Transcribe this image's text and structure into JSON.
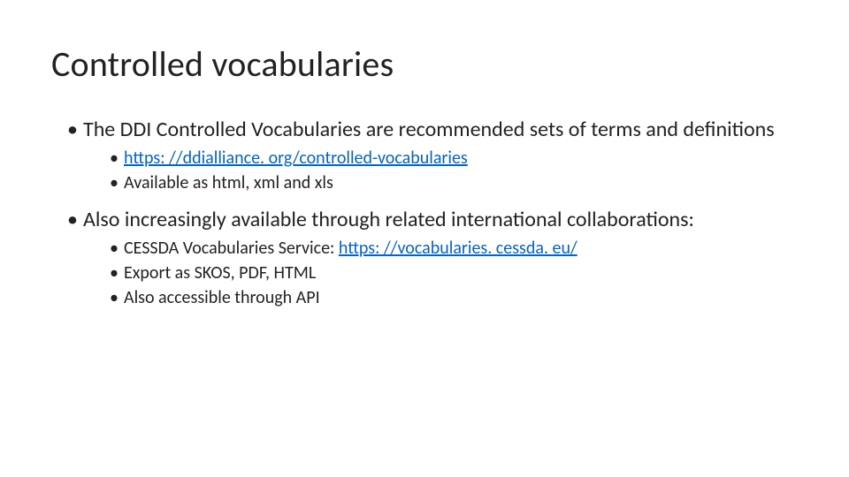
{
  "title": "Controlled vocabularies",
  "bullets": {
    "b1": "The DDI Controlled Vocabularies are recommended sets of terms and definitions",
    "b1_sub1_link": "https: //ddialliance. org/controlled-vocabularies",
    "b1_sub2": "Available as html, xml and xls",
    "b2": "Also increasingly available through related international collaborations:",
    "b2_sub1_prefix": "CESSDA Vocabularies Service: ",
    "b2_sub1_link": "https: //vocabularies. cessda. eu/",
    "b2_sub2": "Export as SKOS, PDF, HTML",
    "b2_sub3": "Also accessible through API"
  }
}
